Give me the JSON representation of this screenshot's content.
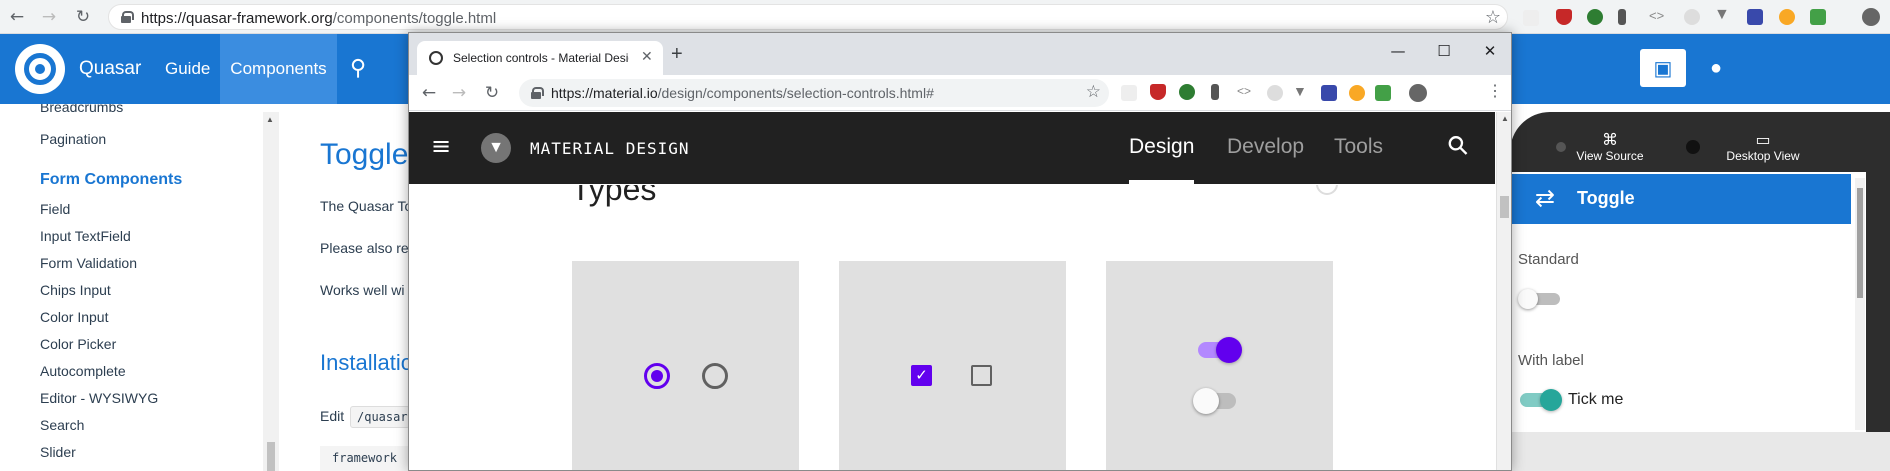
{
  "bg_browser": {
    "url_host": "https://quasar-framework.org",
    "url_path": "/components/toggle.html",
    "nav_icons": [
      "back-icon",
      "forward-icon",
      "reload-icon"
    ],
    "extension_icons": [
      "puzzle-icon",
      "shield-icon",
      "leaf-icon",
      "dropper-icon",
      "code-icon",
      "circle-icon",
      "v-icon",
      "book-icon",
      "cookie-icon",
      "check-icon",
      "avatar-icon"
    ]
  },
  "quasar": {
    "brand": "Quasar",
    "nav": [
      "Guide",
      "Components"
    ],
    "active_nav": "Components",
    "accent": "#1976d2",
    "sidebar": {
      "partial_top": "Breadcrumbs",
      "top_items": [
        "Pagination"
      ],
      "section": "Form Components",
      "items": [
        "Field",
        "Input TextField",
        "Form Validation",
        "Chips Input",
        "Color Input",
        "Color Picker",
        "Autocomplete",
        "Editor - WYSIWYG",
        "Search",
        "Slider"
      ]
    },
    "content": {
      "title": "Toggle",
      "p1": "The Quasar To",
      "p2": "Please also re",
      "p3": "Works well wi",
      "h2": "Installatio",
      "edit_label": "Edit",
      "code_chip": "/quasar",
      "code_block": "framework"
    }
  },
  "device": {
    "view_source": "View Source",
    "desktop_view": "Desktop View",
    "app_title": "Toggle",
    "standard_label": "Standard",
    "with_label": "With label",
    "tick_label": "Tick me",
    "toggle_on_color": "#26a69a"
  },
  "fg_browser": {
    "tab_title": "Selection controls - Material Design",
    "url_host": "https://material.io",
    "url_path": "/design/components/selection-controls.html#",
    "window_controls": [
      "minimize-icon",
      "maximize-icon",
      "close-icon"
    ]
  },
  "material": {
    "brand": "MATERIAL DESIGN",
    "nav": [
      "Design",
      "Develop",
      "Tools"
    ],
    "active": "Design",
    "section_title": "Types",
    "accent": "#6200ee"
  }
}
